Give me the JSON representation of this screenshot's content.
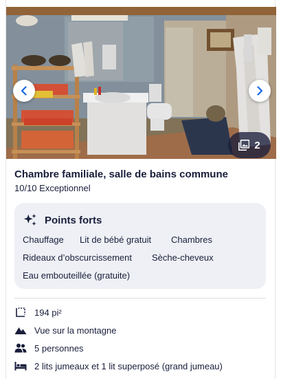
{
  "gallery": {
    "photo_count": "2",
    "photo_icon": "images-icon",
    "prev_icon": "chevron-left-icon",
    "next_icon": "chevron-right-icon"
  },
  "room": {
    "title": "Chambre familiale, salle de bains commune",
    "rating": "10/10 Exceptionnel"
  },
  "highlights": {
    "icon": "sparkle-icon",
    "title": "Points forts",
    "items": [
      "Chauffage",
      "Lit de bébé gratuit",
      "Chambres",
      "Rideaux d’obscurcissement",
      "Sèche-cheveux",
      "Eau embouteillée (gratuite)"
    ]
  },
  "features": [
    {
      "icon": "area-icon",
      "label": "194 pi²"
    },
    {
      "icon": "mountain-icon",
      "label": "Vue sur la montagne"
    },
    {
      "icon": "people-icon",
      "label": "5 personnes"
    },
    {
      "icon": "bed-icon",
      "label": "2 lits jumeaux et 1 lit superposé (grand jumeau)"
    }
  ],
  "colors": {
    "text": "#191e3b",
    "accent": "#1668e3",
    "panel": "#eef0f5"
  }
}
